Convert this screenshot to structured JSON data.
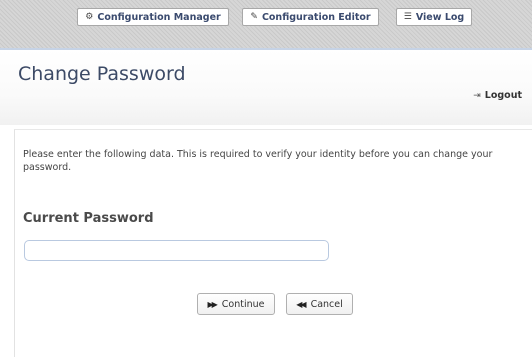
{
  "toolbar": {
    "items": [
      {
        "label": "Configuration Manager",
        "icon": "gears-icon"
      },
      {
        "label": "Configuration Editor",
        "icon": "edit-icon"
      },
      {
        "label": "View Log",
        "icon": "log-list-icon"
      }
    ]
  },
  "header": {
    "title": "Change Password",
    "logout_label": "Logout"
  },
  "form": {
    "instructions": "Please enter the following data. This is required to verify your identity before you can change your password.",
    "current_password_label": "Current Password",
    "current_password_value": "",
    "continue_label": "Continue",
    "cancel_label": "Cancel"
  },
  "colors": {
    "title": "#3c4a66",
    "toolbar_text": "#3a4a6e",
    "input_border": "#b9c9e0"
  }
}
